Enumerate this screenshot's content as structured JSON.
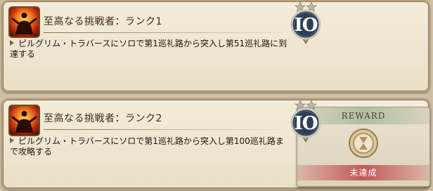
{
  "achievements": [
    {
      "title": "至高なる挑戦者：ランク1",
      "description": "ピルグリム・トラバースにソロで第1巡礼路から突入し第51巡礼路に到達する",
      "badge_text": "IO",
      "badge_stars": 2,
      "icon": "flame-figure-icon"
    },
    {
      "title": "至高なる挑戦者：ランク2",
      "description": "ピルグリム・トラバースにソロで第1巡礼路から突入し第100巡礼路まで攻略する",
      "badge_text": "IO",
      "badge_stars": 2,
      "icon": "flame-figure-icon",
      "reward": {
        "header": "REWARD",
        "status": "未達成",
        "icon": "hourglass-medal-icon"
      }
    }
  ],
  "colors": {
    "badge_fill": "#2d3f55",
    "reward_status": "#c4585a",
    "title_text": "#3e2a14"
  }
}
